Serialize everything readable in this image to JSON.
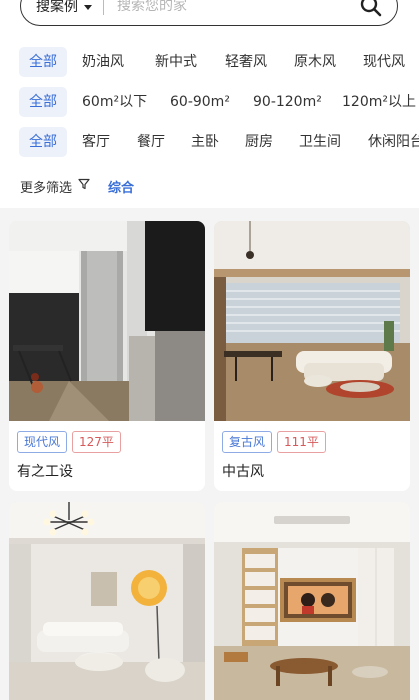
{
  "search": {
    "type_label": "搜案例",
    "placeholder": "搜索您的家"
  },
  "filters": {
    "style_options": [
      "全部",
      "奶油风",
      "新中式",
      "轻奢风",
      "原木风",
      "现代风"
    ],
    "area_options": [
      "全部",
      "60m²以下",
      "60-90m²",
      "90-120m²",
      "120m²以上"
    ],
    "room_options": [
      "全部",
      "客厅",
      "餐厅",
      "主卧",
      "厨房",
      "卫生间",
      "休闲阳台"
    ]
  },
  "more_filters": {
    "label": "更多筛选",
    "combo_label": "综合"
  },
  "cases": [
    {
      "style_tag": "现代风",
      "area_tag": "127平",
      "title": "有之工设"
    },
    {
      "style_tag": "复古风",
      "area_tag": "111平",
      "title": "中古风"
    },
    {
      "style_tag": "",
      "area_tag": "",
      "title": ""
    },
    {
      "style_tag": "",
      "area_tag": "",
      "title": ""
    }
  ],
  "colors": {
    "accent": "#3a6fd8",
    "chip_active_bg": "#edf1fa",
    "tag_style": "#4a78d6",
    "tag_area": "#d65a5a",
    "feed_bg": "#f4f4f4"
  }
}
